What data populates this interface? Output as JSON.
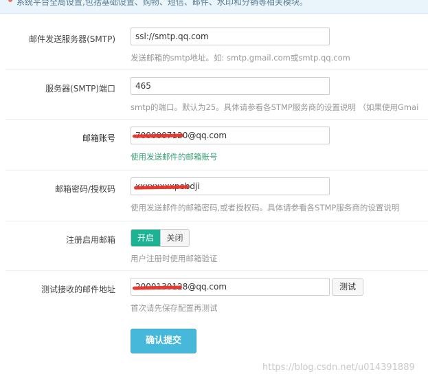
{
  "notice": {
    "text": "系统平台全局设置,包括基础设置、购物、短信、邮件、水印和分销等相关模块。"
  },
  "rows": [
    {
      "label": "邮件发送服务器(SMTP)",
      "value": "ssl://smtp.qq.com",
      "help": "发送邮箱的smtp地址。如: smtp.gmail.com或smtp.qq.com"
    },
    {
      "label": "服务器(SMTP)端口",
      "value": "465",
      "help": "smtp的端口。默认为25。具体请参看各STMP服务商的设置说明 （如果使用Gmai"
    },
    {
      "label": "邮箱账号",
      "value": "7000007120@qq.com",
      "help": "使用发送邮件的邮箱账号"
    },
    {
      "label": "邮箱密码/授权码",
      "value": "xxxxxxxxpebdji",
      "help": "使用发送邮件的邮箱密码,或者授权码。具体请参看各STMP服务商的设置说明"
    },
    {
      "label": "注册启用邮箱",
      "help": "用户注册时使用邮箱验证",
      "toggle_on": "开启",
      "toggle_off": "关闭"
    },
    {
      "label": "测试接收的邮件地址",
      "value": "2000130128@qq.com",
      "help": "首次请先保存配置再测试",
      "test_button": "测试"
    }
  ],
  "submit_label": "确认提交",
  "watermark": "https://blog.csdn.net/u014391889",
  "colors": {
    "accent": "#1bb394",
    "submit": "#46b8da",
    "help_green": "#3aa37a",
    "redaction": "#e5332a"
  }
}
